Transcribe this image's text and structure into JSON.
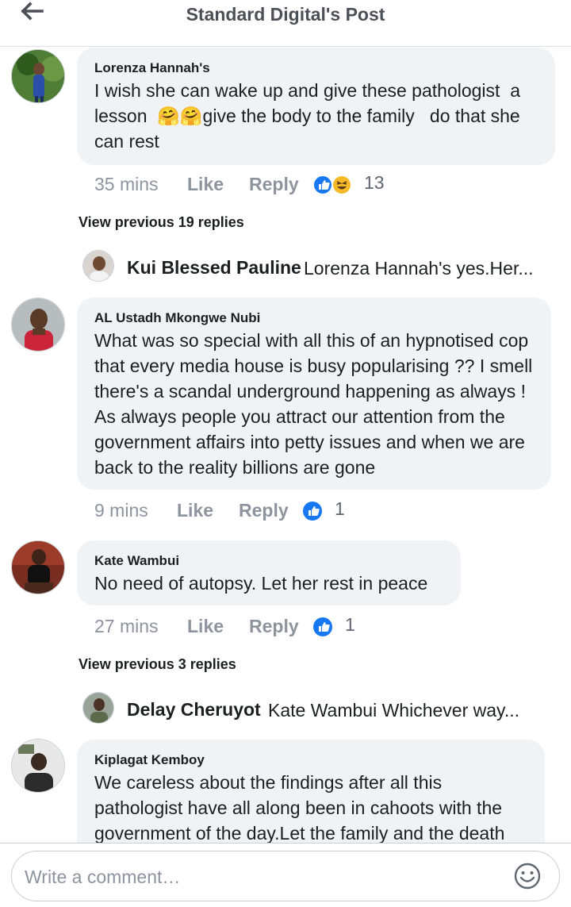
{
  "header": {
    "title": "Standard Digital's Post",
    "back_icon": "arrow-left-icon"
  },
  "comments": [
    {
      "author": "Lorenza Hannah's",
      "text": "I wish she can wake up and give these pathologist  a lesson  🤗🤗give the body to the family   do that she can rest",
      "time": "35 mins",
      "like": "Like",
      "reply": "Reply",
      "reactions": [
        "like",
        "haha"
      ],
      "reaction_count": "13"
    },
    {
      "author": "AL Ustadh Mkongwe Nubi",
      "text": "What was so special with all this of an hypnotised cop that every media house is busy popularising ?? I smell there's a scandal underground happening as always ! As always people you attract our attention from the government affairs into petty issues and when we are back to the reality billions are gone",
      "time": "9 mins",
      "like": "Like",
      "reply": "Reply",
      "reactions": [
        "like"
      ],
      "reaction_count": "1"
    },
    {
      "author": "Kate Wambui",
      "text": "No need of autopsy. Let her rest in peace",
      "time": "27 mins",
      "like": "Like",
      "reply": "Reply",
      "reactions": [
        "like"
      ],
      "reaction_count": "1"
    },
    {
      "author": "Kiplagat Kemboy",
      "text": "We careless about the findings after all this pathologist have all along been in cahoots with the government of the day.Let the family and the death"
    }
  ],
  "view_previous": [
    "View previous 19 replies",
    "View previous 3 replies"
  ],
  "replies": [
    {
      "name": "Kui Blessed Pauline",
      "snippet": "Lorenza Hannah's yes.Her..."
    },
    {
      "name": "Delay Cheruyot",
      "snippet": "Kate Wambui Whichever way..."
    }
  ],
  "composer": {
    "placeholder": "Write a comment…",
    "emoji_icon": "smiley-icon"
  },
  "colors": {
    "like_blue": "#1877f2",
    "haha_yellow": "#f7b928",
    "bubble": "#f0f2f5",
    "meta_grey": "#8d949e"
  }
}
